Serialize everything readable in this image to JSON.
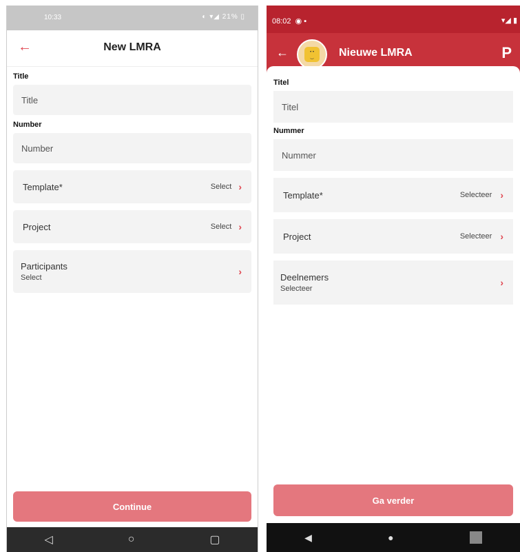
{
  "left": {
    "status": {
      "time": "10:33",
      "icons": "◐ ▾◢ 21% ▯"
    },
    "header": {
      "back": "←",
      "title": "New LMRA"
    },
    "fields": {
      "title_label": "Title",
      "title_placeholder": "Title",
      "number_label": "Number",
      "number_placeholder": "Number"
    },
    "rows": {
      "template_label": "Template*",
      "template_value": "Select",
      "project_label": "Project",
      "project_value": "Select",
      "participants_label": "Participants",
      "participants_value": "Select"
    },
    "chevron": "›",
    "continue": "Continue",
    "nav": {
      "back": "◁",
      "home": "○",
      "recent": "▢"
    }
  },
  "right": {
    "status": {
      "time": "08:02",
      "icons_left": "◉ ▪",
      "icons_right": "▾◢ ▮"
    },
    "header": {
      "back": "←",
      "title": "Nieuwe LMRA",
      "logo": "P"
    },
    "fields": {
      "title_label": "Titel",
      "title_placeholder": "Titel",
      "number_label": "Nummer",
      "number_placeholder": "Nummer"
    },
    "rows": {
      "template_label": "Template*",
      "template_value": "Selecteer",
      "project_label": "Project",
      "project_value": "Selecteer",
      "participants_label": "Deelnemers",
      "participants_value": "Selecteer"
    },
    "chevron": "›",
    "continue": "Ga verder",
    "nav": {
      "back": "◀",
      "home": "●"
    }
  }
}
